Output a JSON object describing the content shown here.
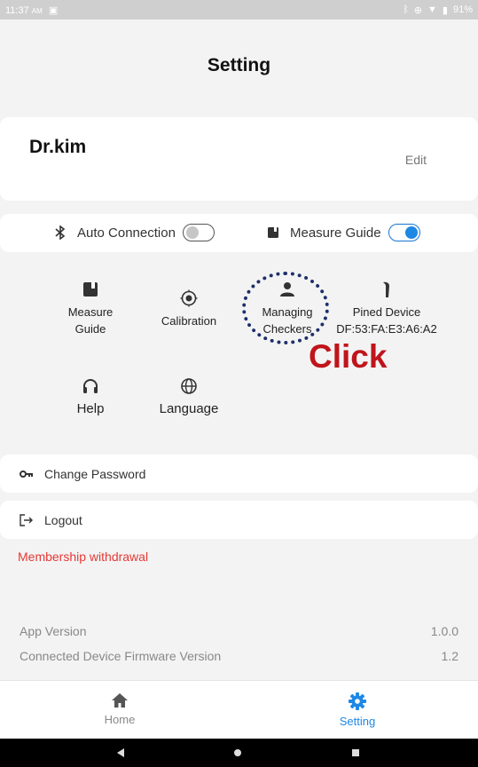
{
  "status_bar": {
    "time": "11:37",
    "ampm": "AM",
    "battery": "91%"
  },
  "title": "Setting",
  "profile": {
    "name": "Dr.kim",
    "edit_label": "Edit"
  },
  "toggles": [
    {
      "label": "Auto Connection",
      "icon": "bluetooth-icon",
      "state": false
    },
    {
      "label": "Measure Guide",
      "icon": "book-icon",
      "state": true
    }
  ],
  "grid": {
    "measure_guide": [
      "Measure",
      "Guide"
    ],
    "calibration": "Calibration",
    "managing_checkers": [
      "Managing",
      "Checkers"
    ],
    "pined_device": {
      "label": "Pined Device",
      "address": "DF:53:FA:E3:A6:A2"
    },
    "help": "Help",
    "language": "Language"
  },
  "annotation": {
    "click_label": "Click",
    "color": "#c0141b"
  },
  "rows": {
    "change_password": "Change Password",
    "logout": "Logout"
  },
  "membership_withdrawal": "Membership withdrawal",
  "info": {
    "app_version_label": "App Version",
    "app_version_value": "1.0.0",
    "firmware_label": "Connected Device Firmware Version",
    "firmware_value": "1.2"
  },
  "bottom_nav": {
    "home": "Home",
    "setting": "Setting",
    "active": "setting"
  },
  "colors": {
    "accent": "#1e88e5",
    "danger": "#e53935"
  }
}
